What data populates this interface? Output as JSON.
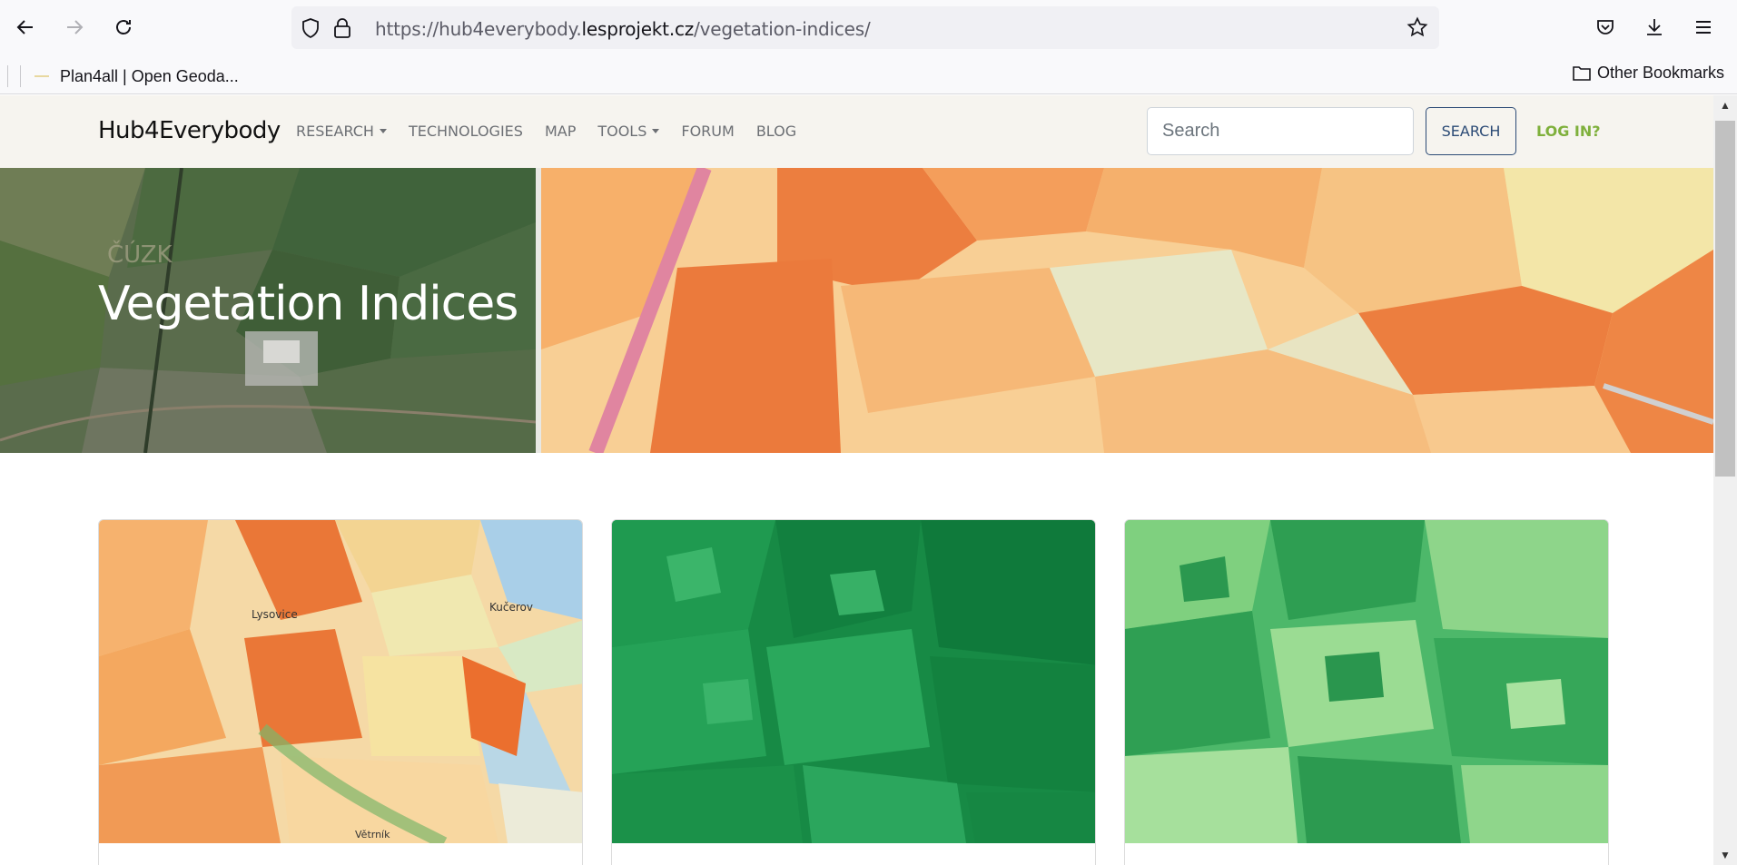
{
  "browser": {
    "url_prefix": "https://hub4everybody.",
    "url_host": "lesprojekt.cz",
    "url_path": "/vegetation-indices/",
    "bookmark_label": "Plan4all | Open Geoda...",
    "other_bookmarks": "Other Bookmarks"
  },
  "site": {
    "brand": "Hub4Everybody",
    "nav": [
      {
        "label": "RESEARCH",
        "dropdown": true
      },
      {
        "label": "TECHNOLOGIES",
        "dropdown": false
      },
      {
        "label": "MAP",
        "dropdown": false
      },
      {
        "label": "TOOLS",
        "dropdown": true
      },
      {
        "label": "FORUM",
        "dropdown": false
      },
      {
        "label": "BLOG",
        "dropdown": false
      }
    ],
    "search_placeholder": "Search",
    "search_button": "SEARCH",
    "login": "LOG IN?",
    "accent": "#7fb03c",
    "primary": "#2c4b76"
  },
  "hero": {
    "title": "Vegetation Indices",
    "watermark": "ČÚZK"
  },
  "cards": [
    {
      "image": "vegetation index map (orange/yellow/blue)",
      "place_labels": [
        "Lysovice",
        "Kučerov",
        "Větrník"
      ]
    },
    {
      "image": "dark green satellite index map"
    },
    {
      "image": "light green satellite index map"
    }
  ]
}
